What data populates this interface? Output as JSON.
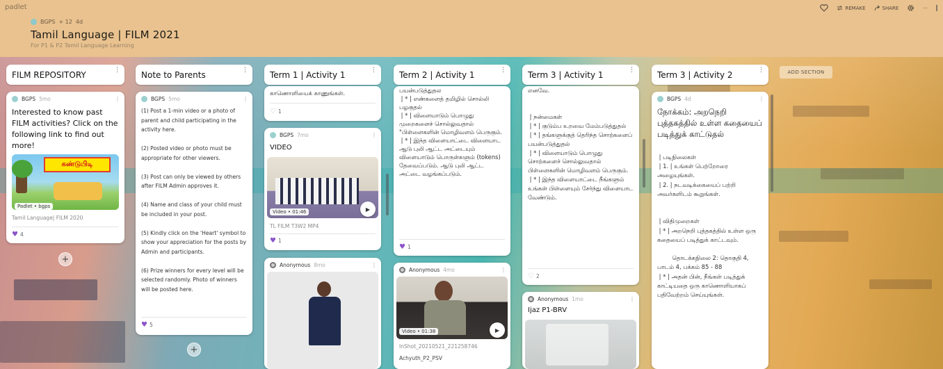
{
  "header": {
    "brand": "padlet",
    "author": "BGPS",
    "contributors": "+ 12",
    "age": "4d",
    "title": "Tamil Language | FILM 2021",
    "subtitle": "For P1 & P2 Tamil Language Learning",
    "remake_label": "REMAKE",
    "share_label": "SHARE",
    "more_label": "···"
  },
  "add_section_label": "ADD SECTION",
  "columns": [
    {
      "title": "FILM REPOSITORY"
    },
    {
      "title": "Note to Parents"
    },
    {
      "title": "Term 1 | Activity 1"
    },
    {
      "title": "Term 2 | Activity 1"
    },
    {
      "title": "Term 3 | Activity 1"
    },
    {
      "title": "Term 3 | Activity 2"
    }
  ],
  "posts": {
    "repo": {
      "author": "BGPS",
      "age": "5mo",
      "text": "Interested to know past FILM activities? Click on the following link to find out more!",
      "link_banner": "கண்டுபிடி",
      "link_pill": "Padlet • bgps",
      "link_caption": "Tamil Language| FILM 2020",
      "likes": "4"
    },
    "note": {
      "author": "BGPS",
      "age": "5mo",
      "text": "(1) Post a 1-min video or a photo of parent and child participating in the activity here.\n\n(2) Posted video or photo must be appropriate for other viewers.\n\n(3) Post can only be viewed by others after FILM Admin approves it.\n\n(4) Name and class of your child must be included in your post.\n\n(5) Kindly click on the 'Heart' symbol to show your appreciation for the posts by Admin and participants.\n\n(6) Prize winners for every level will be selected randomly. Photo of winners will be posted here.",
      "likes": "5"
    },
    "t1a": {
      "text": "காணொளியைக் காணுங்கள்.",
      "likes": "1"
    },
    "t1b": {
      "author": "BGPS",
      "age": "7mo",
      "heading": "VIDEO",
      "video_pill": "Video • 01:46",
      "caption": "TL FILM T3W2 MP4",
      "likes": "1"
    },
    "t1c": {
      "author": "Anonymous",
      "age": "8mo"
    },
    "t2a": {
      "text": "பயன்படுத்துதல\n | * | எண்களைத் தமிழில் சொல்லி பழகுதல்\n | * | விளையாடும் பொழுது முறைகளைச் சொல்லுவதால் \"பிள்ளைகளின் மொழிவளம் பெருகும்.\n | * | இந்த விளையாட்டை விளையாட ஆடு புலி ஆட்ட அட்டையும் விளையாடும் பொருள்களும் (tokens) தேவைப்படும். ஆடு புலி ஆட்ட அட்டை வழங்கப்படும்.",
      "likes": "1"
    },
    "t2b": {
      "author": "Anonymous",
      "age": "4mo",
      "video_pill": "Video • 01:38",
      "caption": "InShot_20210521_221258746",
      "caption2": "Achyuth_P2_PSV"
    },
    "t3a": {
      "text": "எனவே.\n\n\n | நன்மைகள்\n | * | குடும்ப உறவை மேம்படுத்துதல்\n | * | தங்களுக்குத் தெரிந்த சொற்களைப் பயன்படுத்துதல்\n | * | விளையாடும் பொழுது சொற்களைச் சொல்லுவதால் பிள்ளைகளின் மொழிவளம் பெருகும்.\n | * | இந்த விளையாட்டை நீங்களும் உங்கள் பிள்ளையும் சேர்ந்து விளையாட வேண்டும்.",
      "likes": "2"
    },
    "t3b": {
      "author": "Anonymous",
      "age": "1mo",
      "heading": "Ijaz P1-BRV"
    },
    "t3c": {
      "author": "BGPS",
      "age": "4d",
      "heading": "நோக்கம்: அறநெறி புத்தகத்தில் உள்ள கதையைப் படித்துக் காட்டுதல்",
      "text": " | படிநிலைகள்\n | 1. | உங்கள் பெற்றோரை அழையுங்கள்.\n | 2. | நடவடிக்கையைப் பற்றி அவர்களிடம் கூறுங்கள்.\n\n\n | விதிமுறைகள்\n | * | அறநெறி புத்தகத்தில் உள்ள ஒரு கதையைப் படித்துக் காட்டவும்.\n\n        தொடக்கநிலை 2: தொகுதி 4, பாடம் 4, பக்கம் 85 - 88\n | * | அதன் பின், நீங்கள் படித்துக் காட்டியதை ஒரு காணொளியாகப் பதிவேற்றம் செய்யுங்கள்."
    }
  }
}
